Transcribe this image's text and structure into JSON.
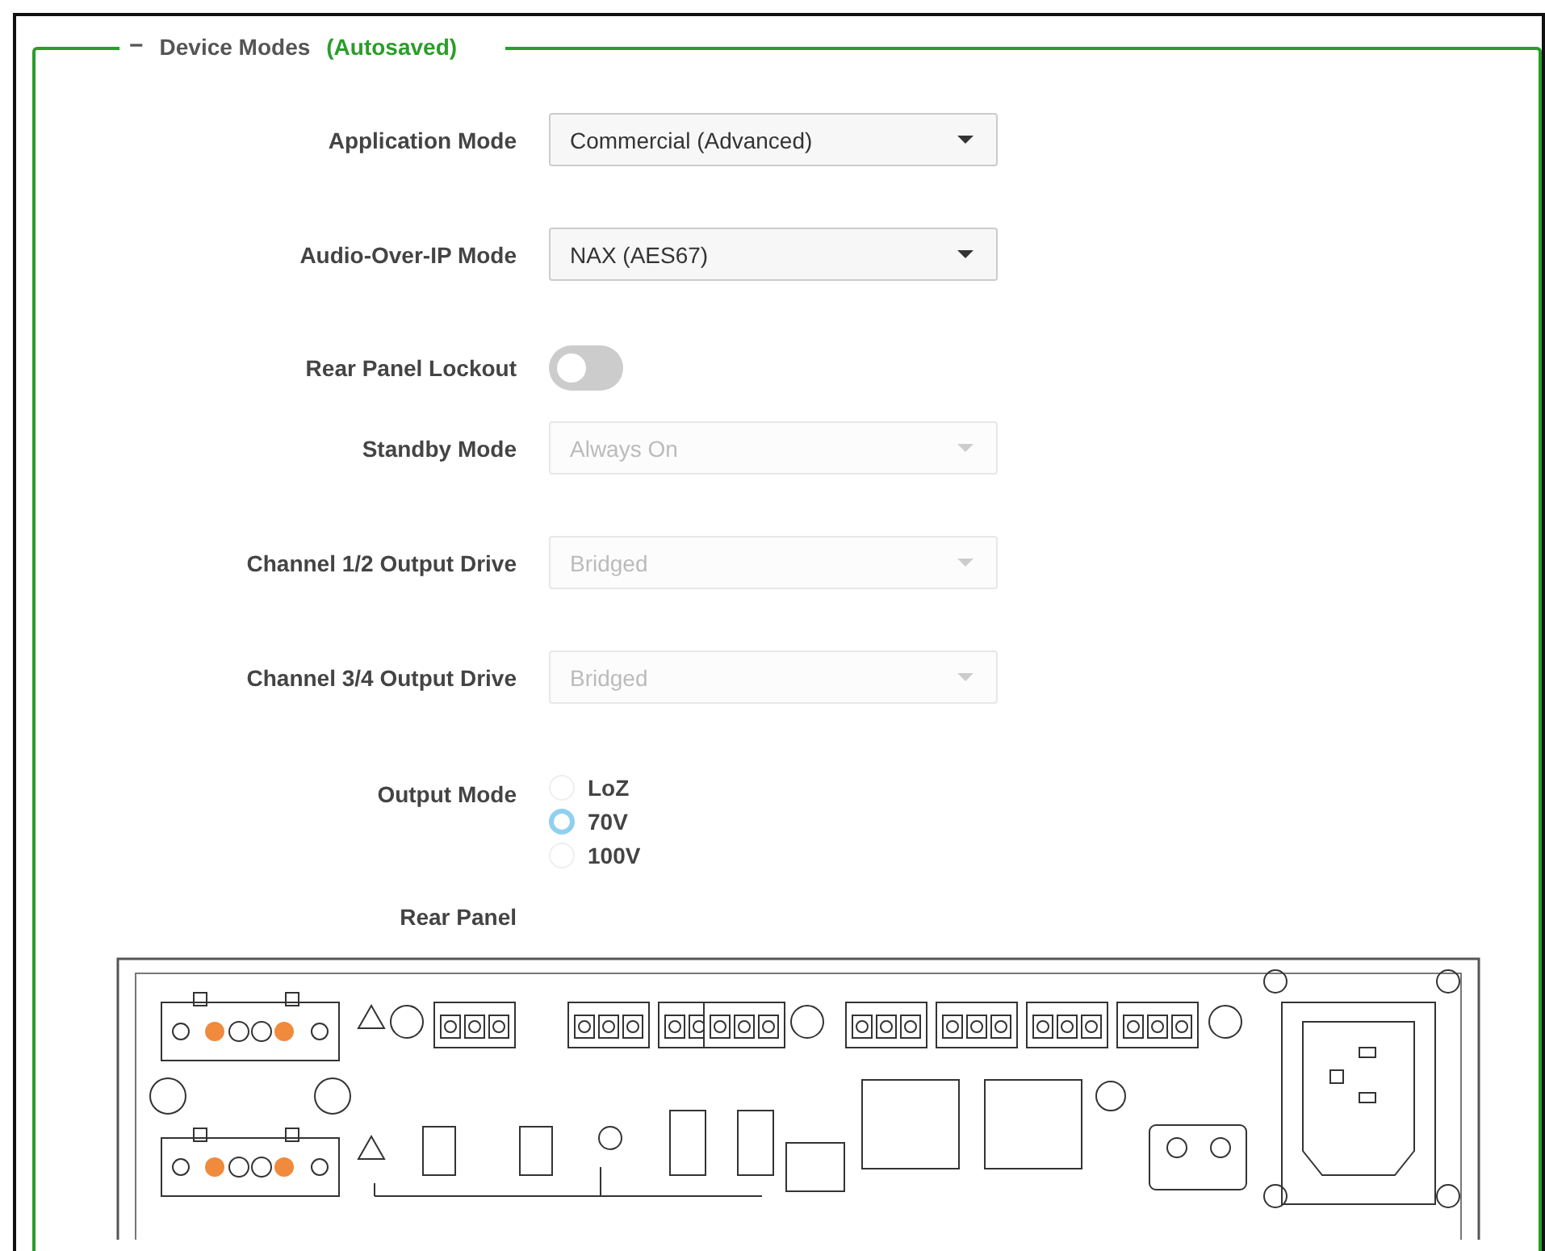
{
  "section": {
    "expanded": true,
    "symbol": "−",
    "title": "Device Modes",
    "status": "(Autosaved)"
  },
  "fields": [
    {
      "kind": "select",
      "label": "Application Mode",
      "value": "Commercial (Advanced)",
      "disabled": false
    },
    {
      "kind": "select",
      "label": "Audio-Over-IP Mode",
      "value": "NAX (AES67)",
      "disabled": false
    },
    {
      "kind": "toggle",
      "label": "Rear Panel Lockout",
      "on": false
    },
    {
      "kind": "select",
      "label": "Standby Mode",
      "value": "Always On",
      "disabled": true
    },
    {
      "kind": "select",
      "label": "Channel 1/2 Output Drive",
      "value": "Bridged",
      "disabled": true
    },
    {
      "kind": "select",
      "label": "Channel 3/4 Output Drive",
      "value": "Bridged",
      "disabled": true
    },
    {
      "kind": "radio",
      "label": "Output Mode",
      "options": [
        {
          "label": "LoZ",
          "selected": false
        },
        {
          "label": "70V",
          "selected": true
        },
        {
          "label": "100V",
          "selected": false
        }
      ]
    },
    {
      "kind": "image",
      "label": "Rear Panel"
    }
  ]
}
